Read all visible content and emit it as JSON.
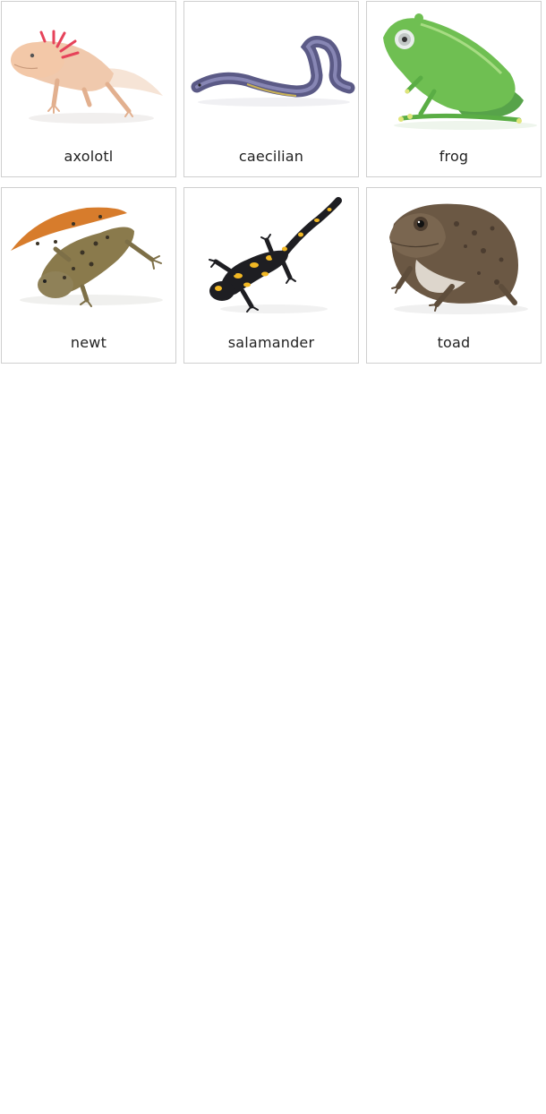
{
  "cards": [
    {
      "label": "axolotl",
      "icon": "axolotl-illustration"
    },
    {
      "label": "caecilian",
      "icon": "caecilian-illustration"
    },
    {
      "label": "frog",
      "icon": "frog-illustration"
    },
    {
      "label": "newt",
      "icon": "newt-illustration"
    },
    {
      "label": "salamander",
      "icon": "salamander-illustration"
    },
    {
      "label": "toad",
      "icon": "toad-illustration"
    }
  ]
}
